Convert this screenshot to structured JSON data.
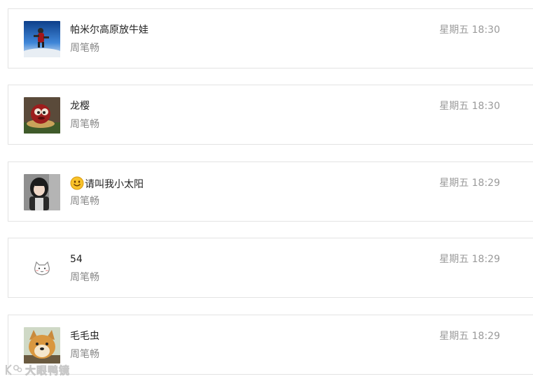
{
  "conversations": [
    {
      "name": "帕米尔高原放牛娃",
      "subtitle": "周笔畅",
      "time": "星期五 18:30",
      "avatar": "skydiver-photo",
      "has_emoji": false
    },
    {
      "name": "龙樱",
      "subtitle": "周笔畅",
      "time": "星期五 18:30",
      "avatar": "red-creature-photo",
      "has_emoji": false
    },
    {
      "name": "请叫我小太阳",
      "subtitle": "周笔畅",
      "time": "星期五 18:29",
      "avatar": "girl-photo",
      "has_emoji": true,
      "emoji": "smiley-icon"
    },
    {
      "name": "54",
      "subtitle": "周笔畅",
      "time": "星期五 18:29",
      "avatar": "cat-doodle",
      "has_emoji": false
    },
    {
      "name": "毛毛虫",
      "subtitle": "周笔畅",
      "time": "星期五 18:29",
      "avatar": "shiba-dog-photo",
      "has_emoji": false
    }
  ],
  "watermark": {
    "text": "大眼鸭镜"
  },
  "colors": {
    "border": "#e3e3e3",
    "name": "#222222",
    "subtitle": "#888888",
    "time": "#9a9a9a"
  }
}
